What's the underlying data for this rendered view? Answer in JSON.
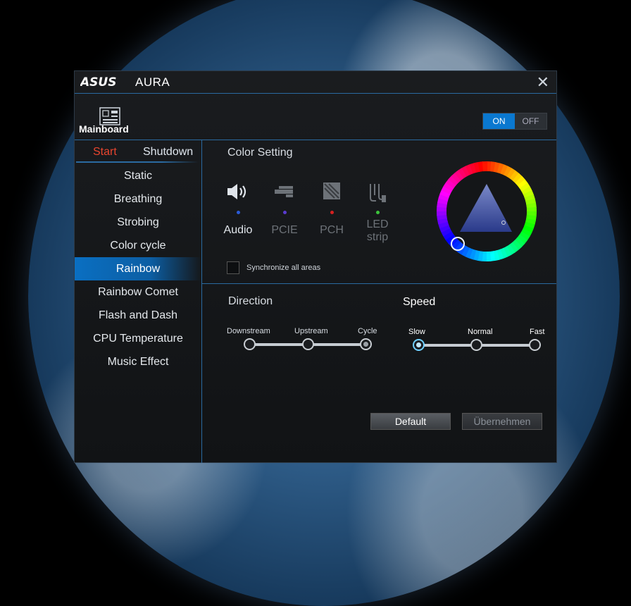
{
  "window": {
    "brand": "ASUS",
    "title": "AURA"
  },
  "device": {
    "label": "Mainboard"
  },
  "power": {
    "on": "ON",
    "off": "OFF"
  },
  "tabs": {
    "start": "Start",
    "shutdown": "Shutdown"
  },
  "effects": [
    {
      "label": "Static"
    },
    {
      "label": "Breathing"
    },
    {
      "label": "Strobing"
    },
    {
      "label": "Color cycle"
    },
    {
      "label": "Rainbow",
      "active": true
    },
    {
      "label": "Rainbow Comet"
    },
    {
      "label": "Flash and Dash"
    },
    {
      "label": "CPU Temperature"
    },
    {
      "label": "Music Effect"
    }
  ],
  "color_setting": {
    "title": "Color Setting",
    "areas": [
      {
        "label": "Audio",
        "dot_color": "#2a5bd7",
        "enabled": true
      },
      {
        "label": "PCIE",
        "dot_color": "#5a3bd0",
        "enabled": false
      },
      {
        "label": "PCH",
        "dot_color": "#d62020",
        "enabled": false
      },
      {
        "label": "LED strip",
        "label_l1": "LED",
        "label_l2": "strip",
        "dot_color": "#3cc43c",
        "enabled": false
      }
    ],
    "sync_label": "Synchronize all areas"
  },
  "direction": {
    "title": "Direction",
    "options": [
      "Downstream",
      "Upstream",
      "Cycle"
    ],
    "selected": "Cycle"
  },
  "speed": {
    "title": "Speed",
    "options": [
      "Slow",
      "Normal",
      "Fast"
    ],
    "selected": "Slow"
  },
  "buttons": {
    "default": "Default",
    "apply": "Übernehmen"
  },
  "colors": {
    "accent": "#0a78d0",
    "start_tab": "#e8452f",
    "border": "#2a6aa0"
  }
}
